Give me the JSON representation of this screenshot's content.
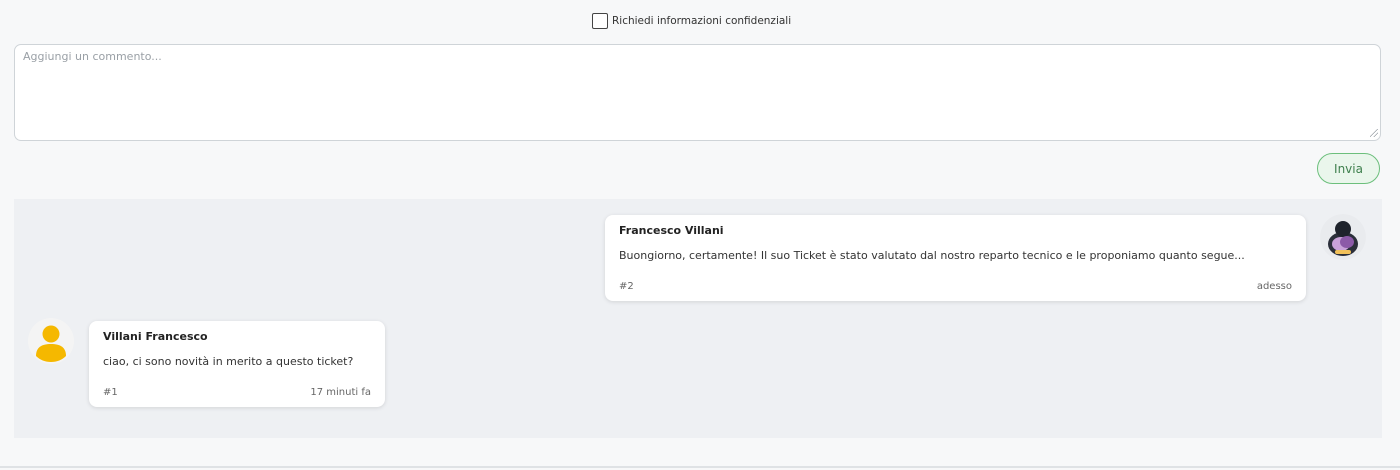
{
  "confidential": {
    "label": "Richiedi informazioni confidenziali",
    "checked": false
  },
  "comment": {
    "placeholder": "Aggiungi un commento...",
    "value": ""
  },
  "send_button": {
    "label": "Invia",
    "color": "#3e7f4d"
  },
  "messages": [
    {
      "author": "Francesco Villani",
      "text": "Buongiorno, certamente! Il suo Ticket è stato valutato dal nostro reparto tecnico e le proponiamo quanto segue...",
      "number": "#2",
      "time": "adesso",
      "side": "right",
      "avatar": "user-photo-avatar"
    },
    {
      "author": "Villani Francesco",
      "text": "ciao, ci sono novità in merito a questo ticket?",
      "number": "#1",
      "time": "17 minuti fa",
      "side": "left",
      "avatar": "default-user-avatar-icon",
      "avatar_color": "#f5b800"
    }
  ]
}
